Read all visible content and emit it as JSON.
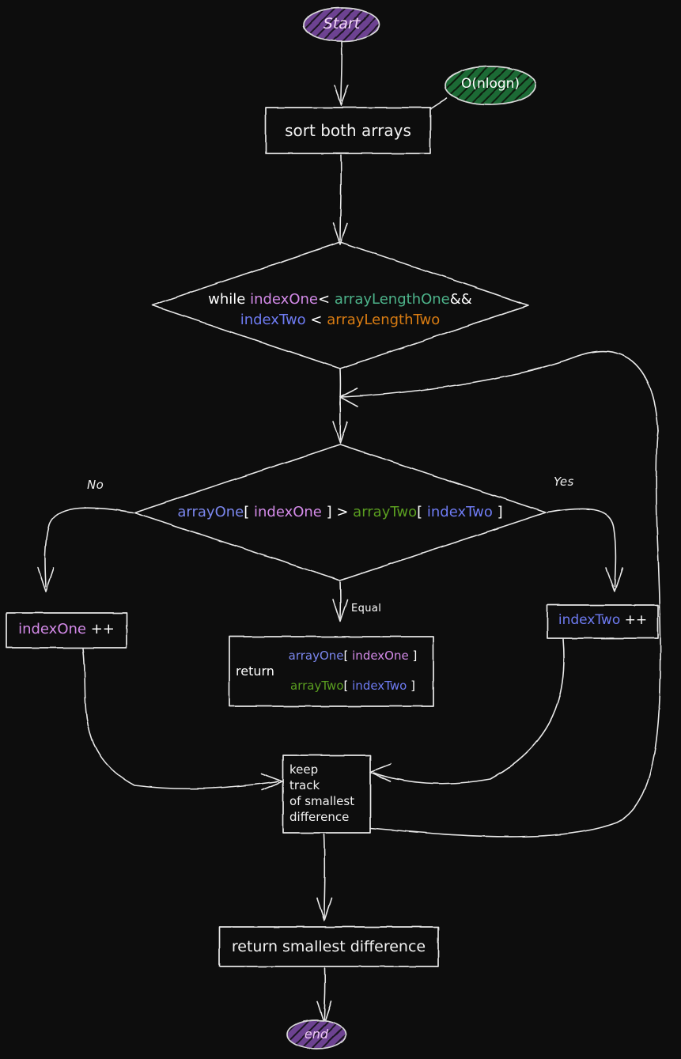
{
  "diagram": {
    "title": "smallest difference two arrays flowchart",
    "background": "#0d0d0d",
    "stroke": "#e8e8e8",
    "colors": {
      "indexOne": "#d38ae8",
      "indexTwo": "#6e7bf2",
      "arrayOne": "#7b87ee",
      "arrayTwo": "#5a9e20",
      "arrayLengthOne": "#4db38a",
      "arrayLengthTwo": "#d97c12",
      "plain": "#ffffff",
      "startFill": "#7a4fa3",
      "startText": "#f3d6f7",
      "noteFill": "#1f6b35",
      "noteText": "#ffffff",
      "endFill": "#7a4fa3",
      "endText": "#eec8f5"
    }
  },
  "nodes": {
    "start": {
      "label": "Start",
      "shape": "ellipse"
    },
    "note_complexity": {
      "label": "O(nlogn)",
      "shape": "ellipse"
    },
    "sort": {
      "label": "sort both arrays",
      "shape": "rect"
    },
    "while_condition": {
      "shape": "diamond",
      "line1": [
        {
          "text": "while ",
          "color": "plain"
        },
        {
          "text": "indexOne",
          "color": "indexOne"
        },
        {
          "text": "< ",
          "color": "plain"
        },
        {
          "text": "arrayLengthOne",
          "color": "arrayLengthOne"
        },
        {
          "text": "&&",
          "color": "plain"
        }
      ],
      "line2": [
        {
          "text": "indexTwo",
          "color": "indexTwo"
        },
        {
          "text": " < ",
          "color": "plain"
        },
        {
          "text": "arrayLengthTwo",
          "color": "arrayLengthTwo"
        }
      ]
    },
    "compare": {
      "shape": "diamond",
      "line1": [
        {
          "text": "arrayOne",
          "color": "arrayOne"
        },
        {
          "text": "[ ",
          "color": "plain"
        },
        {
          "text": "indexOne",
          "color": "indexOne"
        },
        {
          "text": " ] > ",
          "color": "plain"
        },
        {
          "text": "arrayTwo",
          "color": "arrayTwo"
        },
        {
          "text": "[ ",
          "color": "plain"
        },
        {
          "text": "indexTwo",
          "color": "indexTwo"
        },
        {
          "text": " ]",
          "color": "plain"
        }
      ]
    },
    "index_one_inc": {
      "shape": "rect",
      "parts": [
        {
          "text": "indexOne",
          "color": "indexOne"
        },
        {
          "text": " ++",
          "color": "plain"
        }
      ]
    },
    "index_two_inc": {
      "shape": "rect",
      "parts": [
        {
          "text": "indexTwo",
          "color": "indexTwo"
        },
        {
          "text": " ++",
          "color": "plain"
        }
      ]
    },
    "return_pair": {
      "shape": "rect",
      "keyword": "return",
      "top": [
        {
          "text": "arrayOne",
          "color": "arrayOne"
        },
        {
          "text": "[ ",
          "color": "plain"
        },
        {
          "text": "indexOne",
          "color": "indexOne"
        },
        {
          "text": " ]",
          "color": "plain"
        }
      ],
      "bottom": [
        {
          "text": "arrayTwo",
          "color": "arrayTwo"
        },
        {
          "text": "[ ",
          "color": "plain"
        },
        {
          "text": "indexTwo",
          "color": "indexTwo"
        },
        {
          "text": " ]",
          "color": "plain"
        }
      ]
    },
    "keep_track": {
      "shape": "rect",
      "lines": [
        "keep",
        "track",
        "of smallest",
        "difference"
      ]
    },
    "return_smallest": {
      "label": "return smallest difference",
      "shape": "rect"
    },
    "end": {
      "label": "end",
      "shape": "ellipse"
    }
  },
  "edge_labels": {
    "no": "No",
    "yes": "Yes",
    "equal": "Equal"
  }
}
